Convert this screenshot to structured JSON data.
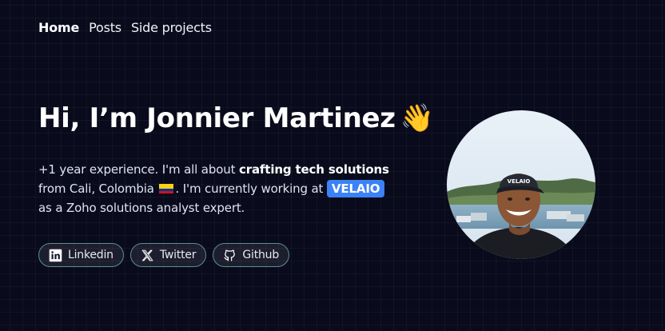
{
  "nav": {
    "home": "Home",
    "posts": "Posts",
    "side_projects": "Side projects"
  },
  "hero": {
    "title": "Hi, I’m Jonnier Martinez",
    "wave": "👋",
    "bio_1": "+1 year experience. I'm all about ",
    "bio_strong": "crafting tech solutions",
    "bio_2": " from Cali, Colombia ",
    "bio_3": ". I'm currently working at ",
    "company": "VELAIO",
    "bio_4": " as a Zoho solutions analyst expert."
  },
  "socials": {
    "linkedin": "Linkedin",
    "twitter": "Twitter",
    "github": "Github"
  },
  "avatar": {
    "cap_text": "VELAIO"
  },
  "colors": {
    "background": "#090b1c",
    "badge": "#3b82f6",
    "social_border": "#5b8f8f"
  },
  "icons": [
    "linkedin-icon",
    "x-twitter-icon",
    "github-icon",
    "colombia-flag-icon",
    "waving-hand-icon"
  ]
}
